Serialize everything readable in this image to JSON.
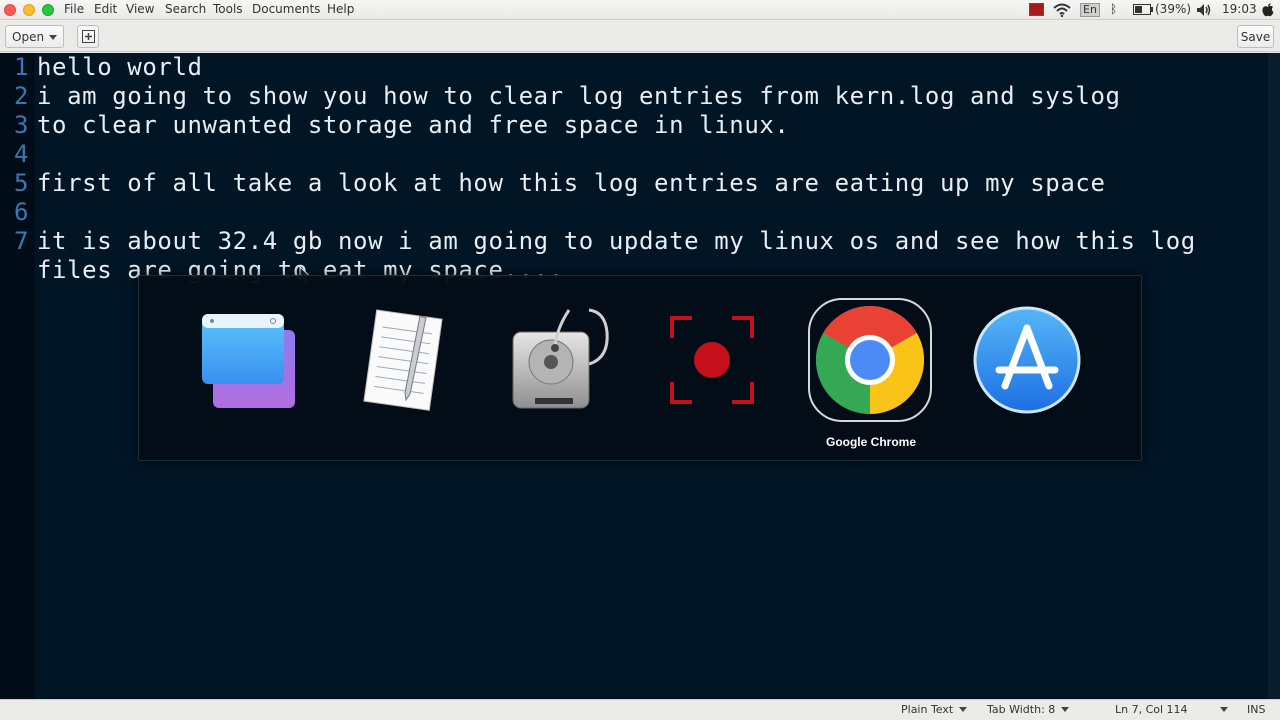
{
  "menubar": {
    "items": [
      "File",
      "Edit",
      "View",
      "Search",
      "Tools",
      "Documents",
      "Help"
    ],
    "tray": {
      "keyboard_layout": "En",
      "battery": "(39%)",
      "clock": "19:03"
    }
  },
  "toolbar": {
    "open_label": "Open",
    "save_label": "Save"
  },
  "editor": {
    "line_numbers": [
      "1",
      "2",
      "3",
      "4",
      "5",
      "6",
      "7"
    ],
    "lines": [
      "hello world",
      "i am going to show you how to clear log entries from kern.log and syslog",
      "to clear unwanted storage and free space in linux.",
      "",
      "first of all take a look at how this log entries are eating up my space",
      "",
      "it is about 32.4 gb now i am going to update my linux os and see how this log",
      "files are going to eat my space...."
    ],
    "colors": {
      "background": "#011525",
      "text": "#e8eef3",
      "line_number": "#3c78b0"
    }
  },
  "app_switcher": {
    "apps": [
      {
        "icon": "finder-window-icon"
      },
      {
        "icon": "text-editor-icon"
      },
      {
        "icon": "disk-utility-icon"
      },
      {
        "icon": "screen-recorder-icon"
      },
      {
        "icon": "chrome-icon"
      },
      {
        "icon": "app-store-icon"
      }
    ],
    "selected_label": "Google Chrome"
  },
  "statusbar": {
    "language": "Plain Text",
    "tab_width": "Tab Width: 8",
    "position": "Ln 7, Col 114",
    "mode": "INS"
  }
}
